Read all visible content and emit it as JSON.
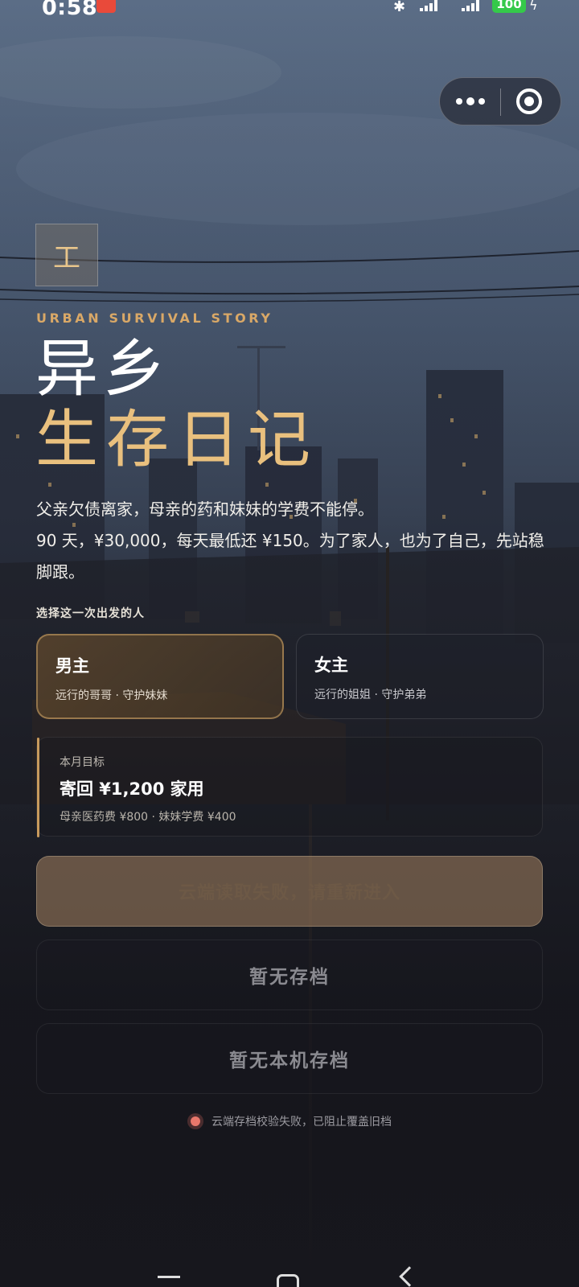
{
  "status_bar": {
    "time": "0:58",
    "battery": "100",
    "icons": [
      "app-notification-icon",
      "bluetooth-icon",
      "signal-icon",
      "signal-icon",
      "battery-icon",
      "charging-icon"
    ]
  },
  "capsule": {
    "more_icon": "more-dots-icon",
    "close_icon": "target-close-icon"
  },
  "header": {
    "logo_char": "工",
    "eyebrow": "URBAN SURVIVAL STORY",
    "title_line1": "异乡",
    "title_line2": "生存日记",
    "intro_line1": "父亲欠债离家，母亲的药和妹妹的学费不能停。",
    "intro_line2": "90 天，¥30,000，每天最低还 ¥150。为了家人，也为了自己，先站稳脚跟。"
  },
  "role_select": {
    "label": "选择这一次出发的人",
    "roles": [
      {
        "name": "男主",
        "desc": "远行的哥哥 · 守护妹妹",
        "selected": true
      },
      {
        "name": "女主",
        "desc": "远行的姐姐 · 守护弟弟",
        "selected": false
      }
    ]
  },
  "goal": {
    "label": "本月目标",
    "main": "寄回 ¥1,200 家用",
    "detail": "母亲医药费 ¥800 · 妹妹学费 ¥400"
  },
  "actions": {
    "cloud_button": "云端读取失败，请重新进入",
    "save_button": "暂无存档",
    "local_save_button": "暂无本机存档"
  },
  "notice": {
    "text": "云端存档校验失败，已阻止覆盖旧档"
  },
  "colors": {
    "accent_gold": "#e9c07e",
    "eyebrow": "#d9a867",
    "error_dot": "#e8776b"
  }
}
